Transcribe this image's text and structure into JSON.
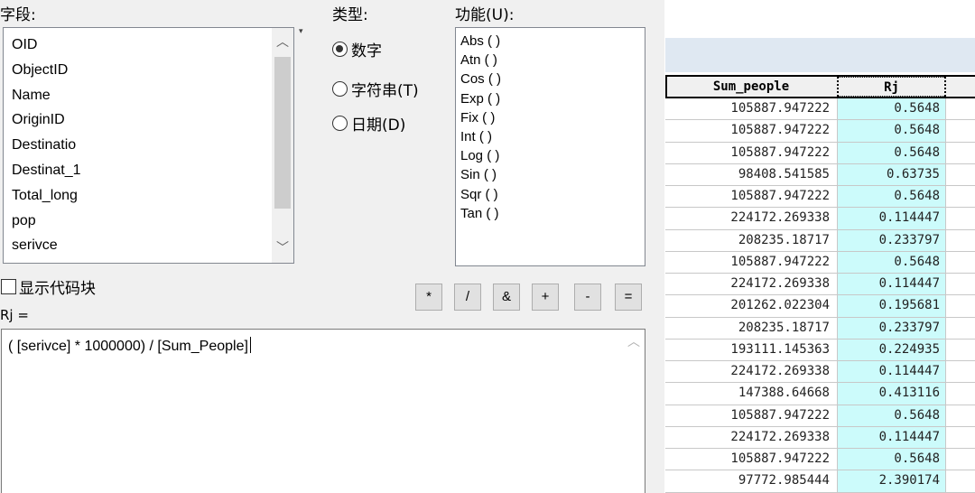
{
  "labels": {
    "fields": "字段:",
    "type": "类型:",
    "functions": "功能(U):",
    "show_codeblock": "显示代码块",
    "target": "Rj ="
  },
  "fields": [
    "OID",
    "ObjectID",
    "Name",
    "OriginID",
    "Destinatio",
    "Destinat_1",
    "Total_long",
    "pop",
    "serivce"
  ],
  "type_options": [
    {
      "label": "数字",
      "selected": true
    },
    {
      "label": "字符串(T)",
      "selected": false
    },
    {
      "label": "日期(D)",
      "selected": false
    }
  ],
  "functions": [
    "Abs ( )",
    "Atn ( )",
    "Cos ( )",
    "Exp ( )",
    "Fix ( )",
    "Int ( )",
    "Log ( )",
    "Sin ( )",
    "Sqr ( )",
    "Tan ( )"
  ],
  "operators": [
    "*",
    "/",
    "&",
    "+",
    "-",
    "="
  ],
  "expression": "( [serivce] * 1000000) / [Sum_People]",
  "table": {
    "columns": [
      "Sum_people",
      "Rj"
    ],
    "rows": [
      [
        "105887.947222",
        "0.5648"
      ],
      [
        "105887.947222",
        "0.5648"
      ],
      [
        "105887.947222",
        "0.5648"
      ],
      [
        "98408.541585",
        "0.63735"
      ],
      [
        "105887.947222",
        "0.5648"
      ],
      [
        "224172.269338",
        "0.114447"
      ],
      [
        "208235.18717",
        "0.233797"
      ],
      [
        "105887.947222",
        "0.5648"
      ],
      [
        "224172.269338",
        "0.114447"
      ],
      [
        "201262.022304",
        "0.195681"
      ],
      [
        "208235.18717",
        "0.233797"
      ],
      [
        "193111.145363",
        "0.224935"
      ],
      [
        "224172.269338",
        "0.114447"
      ],
      [
        "147388.64668",
        "0.413116"
      ],
      [
        "105887.947222",
        "0.5648"
      ],
      [
        "224172.269338",
        "0.114447"
      ],
      [
        "105887.947222",
        "0.5648"
      ],
      [
        "97772.985444",
        "2.390174"
      ]
    ]
  },
  "colors": {
    "dialog_bg": "#f0f0f0",
    "rj_cell_bg": "#ccfbfb",
    "band": "#dfe8f2"
  }
}
